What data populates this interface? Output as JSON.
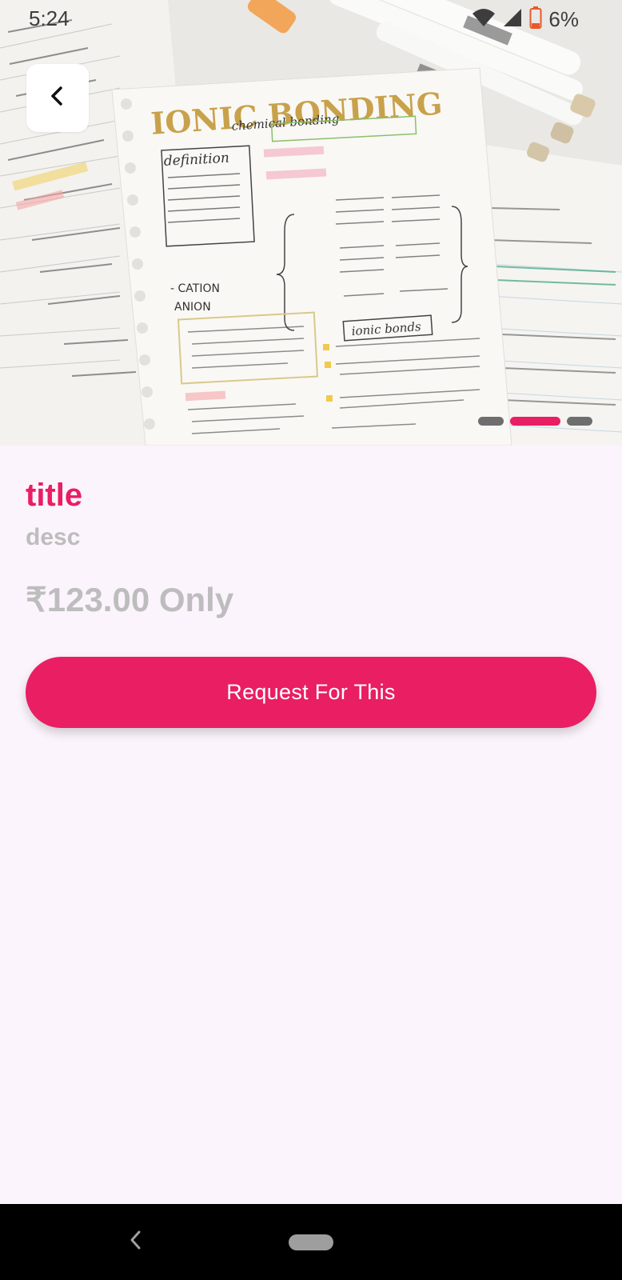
{
  "status_bar": {
    "time": "5:24",
    "battery": "6%"
  },
  "hero": {
    "heading": "IONIC BONDING",
    "subheading": "chemical bonding",
    "carousel_count": 3,
    "carousel_active_index": 1
  },
  "product": {
    "title": "title",
    "description": "desc",
    "price": "₹123.00 Only"
  },
  "actions": {
    "request_label": "Request For This"
  },
  "colors": {
    "accent": "#e91e63",
    "muted_text": "#bdbdbd",
    "background": "#fcf4fc"
  },
  "icons": {
    "back": "chevron-left-icon",
    "wifi": "wifi-icon",
    "signal": "signal-icon",
    "battery": "battery-icon"
  }
}
